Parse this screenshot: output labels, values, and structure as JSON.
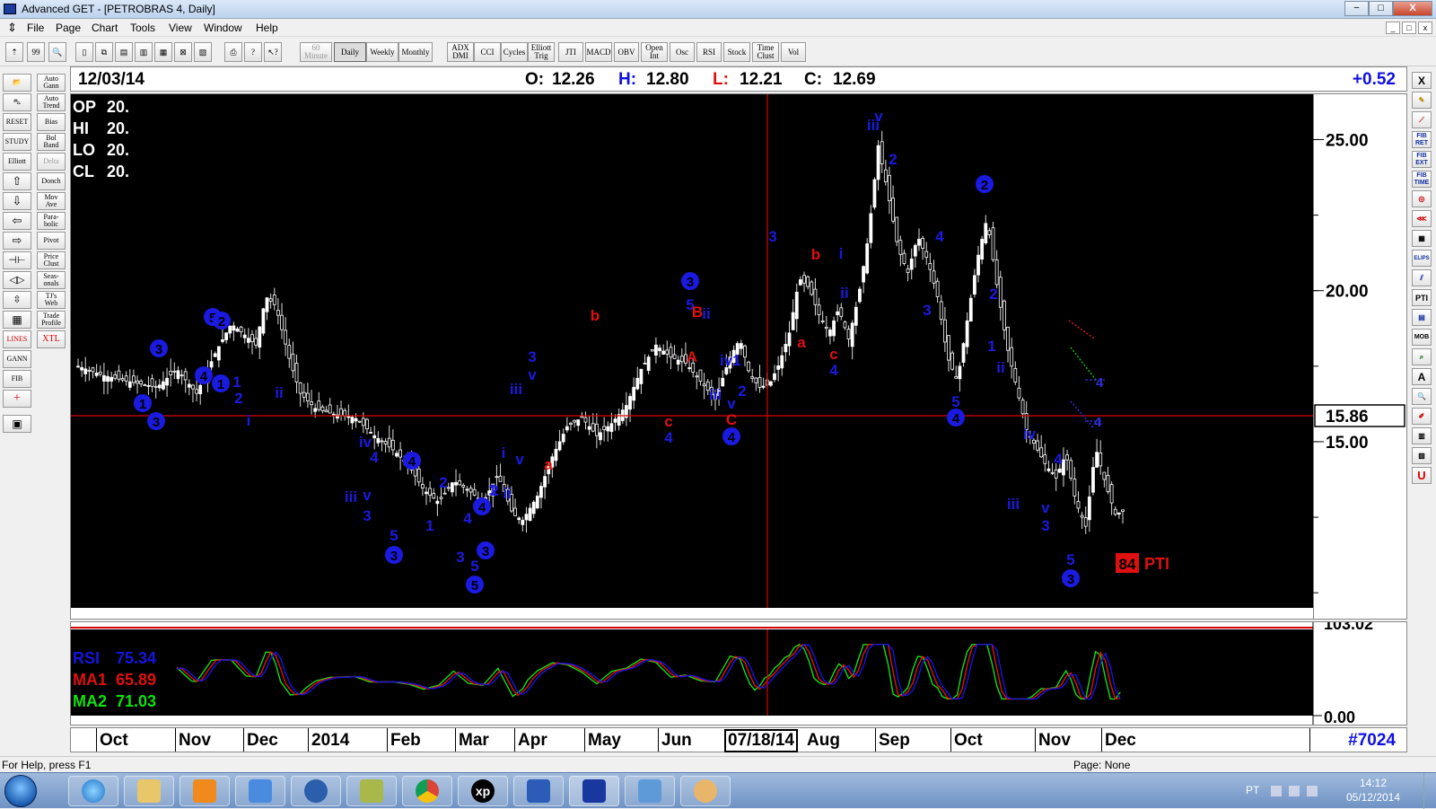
{
  "window": {
    "title": "Advanced GET - [PETROBRAS 4, Daily]",
    "buttons": [
      "−",
      "□",
      "X"
    ]
  },
  "menu": {
    "items": [
      "File",
      "Page",
      "Chart",
      "Tools",
      "View",
      "Window",
      "Help"
    ],
    "mdi_buttons": [
      "_",
      "□",
      "x"
    ]
  },
  "toolbar": {
    "icons": [
      "pointer-icon",
      "quote-icon",
      "zoom-icon",
      "new-icon",
      "copy-icon",
      "page-icon",
      "page2-icon",
      "grid-icon",
      "close-doc-icon",
      "print-icon",
      "help-icon",
      "context-help-icon"
    ],
    "timeframes": {
      "minute": "60\nMinute",
      "daily": "Daily",
      "weekly": "Weekly",
      "monthly": "Monthly"
    },
    "studies": [
      "ADX\nDMI",
      "CCI",
      "Cycles",
      "Elliott\nTrig",
      "JTI",
      "MACD",
      "OBV",
      "Open\nInt",
      "Osc",
      "RSI",
      "Stock",
      "Time\nClust",
      "Vol"
    ]
  },
  "left_tools": {
    "col1_icons": [
      "open-folder-icon",
      "cars-icon",
      "reset-icon",
      "study-icon",
      "elliott-icon",
      "arrow-up-icon",
      "arrow-down-icon",
      "arrow-left-icon",
      "arrow-right-icon",
      "expand-icon",
      "expand-h-icon",
      "compress-icon",
      "grid-icon",
      "lines-icon",
      "gann-icon",
      "fib-icon",
      "crosshair-icon",
      "calculator-icon"
    ],
    "col1_labels": [
      "",
      "",
      "RESET",
      "STUDY",
      "Elliott",
      "",
      "",
      "",
      "",
      "",
      "",
      "",
      "",
      "LINES",
      "GANN",
      "FIB",
      "",
      ""
    ],
    "col2": [
      "Auto\nGann",
      "Auto\nTrend",
      "Bias",
      "Bol\nBand",
      "Delta",
      "Donch",
      "Mov\nAve",
      "Para-\nbolic",
      "Pivot",
      "Price\nClust",
      "Seas-\nonals",
      "TJ's\nWeb",
      "Trade\nProfile",
      "XTL"
    ]
  },
  "right_tools": {
    "icons": [
      "close-icon",
      "pencil-icon",
      "line-icon",
      "fib-ret-icon",
      "fib-ext-icon",
      "fib-time-icon",
      "circle-icon",
      "fan-icon",
      "grid-icon",
      "ellipse-icon",
      "channel-icon",
      "pti-icon",
      "table-icon",
      "mob-icon",
      "magnifier-icon",
      "text-icon",
      "zoom-icon",
      "eraser-icon",
      "layers-icon",
      "layers2-icon",
      "magnet-icon"
    ],
    "labels": [
      "X",
      "",
      "",
      "FIB\nRET",
      "FIB\nEXT",
      "FIB\nTIME",
      "",
      "",
      "",
      "ELIPS",
      "",
      "PTI",
      "",
      "MOB",
      "",
      "A",
      "",
      "",
      "",
      "",
      "U"
    ]
  },
  "info": {
    "date": "12/03/14",
    "open_label": "O:",
    "open": "12.26",
    "high_label": "H:",
    "high": "12.80",
    "low_label": "L:",
    "low": "12.21",
    "close_label": "C:",
    "close": "12.69",
    "change": "+0.52"
  },
  "legend": {
    "op_label": "OP",
    "op_value": "20.",
    "hi_label": "HI",
    "hi_value": "20.",
    "lo_label": "LO",
    "lo_value": "20.",
    "cl_label": "CL",
    "cl_value": "20."
  },
  "chart_data": {
    "type": "candlestick",
    "instrument": "PETROBRAS 4",
    "ylim": [
      9.5,
      26.5
    ],
    "y_ticks": [
      15.0,
      20.0,
      25.0
    ],
    "y_tick_labels": [
      "15.00",
      "20.00",
      "25.00"
    ],
    "crosshair_price": 15.86,
    "crosshair_price_label": "15.86",
    "crosshair_date_label": "07/18/14",
    "x_labels": [
      "Oct",
      "Nov",
      "Dec",
      "2014",
      "Feb",
      "Mar",
      "Apr",
      "May",
      "Jun",
      "Aug",
      "Sep",
      "Oct",
      "Nov",
      "Dec"
    ],
    "bar_count_label": "#7024",
    "pti_value": "84",
    "pti_label": "PTI",
    "price_path": [
      {
        "x": 0,
        "y": 17.5
      },
      {
        "x": 10,
        "y": 17.2
      },
      {
        "x": 20,
        "y": 17.0
      },
      {
        "x": 32,
        "y": 16.8
      },
      {
        "x": 40,
        "y": 17.4
      },
      {
        "x": 48,
        "y": 16.6
      },
      {
        "x": 56,
        "y": 18.0
      },
      {
        "x": 62,
        "y": 18.9
      },
      {
        "x": 68,
        "y": 18.5
      },
      {
        "x": 72,
        "y": 18.2
      },
      {
        "x": 76,
        "y": 19.8
      },
      {
        "x": 80,
        "y": 19.5
      },
      {
        "x": 86,
        "y": 17.6
      },
      {
        "x": 90,
        "y": 16.6
      },
      {
        "x": 96,
        "y": 16.1
      },
      {
        "x": 104,
        "y": 15.9
      },
      {
        "x": 112,
        "y": 15.8
      },
      {
        "x": 120,
        "y": 15.2
      },
      {
        "x": 128,
        "y": 14.7
      },
      {
        "x": 134,
        "y": 14.2
      },
      {
        "x": 140,
        "y": 13.4
      },
      {
        "x": 146,
        "y": 13.0
      },
      {
        "x": 152,
        "y": 13.7
      },
      {
        "x": 158,
        "y": 13.4
      },
      {
        "x": 164,
        "y": 13.0
      },
      {
        "x": 170,
        "y": 13.9
      },
      {
        "x": 176,
        "y": 12.6
      },
      {
        "x": 180,
        "y": 12.4
      },
      {
        "x": 186,
        "y": 13.2
      },
      {
        "x": 192,
        "y": 14.5
      },
      {
        "x": 198,
        "y": 15.5
      },
      {
        "x": 204,
        "y": 15.8
      },
      {
        "x": 210,
        "y": 15.2
      },
      {
        "x": 216,
        "y": 15.6
      },
      {
        "x": 222,
        "y": 16.2
      },
      {
        "x": 228,
        "y": 17.4
      },
      {
        "x": 234,
        "y": 18.2
      },
      {
        "x": 240,
        "y": 17.8
      },
      {
        "x": 246,
        "y": 17.6
      },
      {
        "x": 252,
        "y": 17.0
      },
      {
        "x": 258,
        "y": 16.4
      },
      {
        "x": 264,
        "y": 17.8
      },
      {
        "x": 268,
        "y": 18.4
      },
      {
        "x": 272,
        "y": 17.2
      },
      {
        "x": 276,
        "y": 16.8
      },
      {
        "x": 280,
        "y": 16.9
      },
      {
        "x": 284,
        "y": 17.6
      },
      {
        "x": 288,
        "y": 18.6
      },
      {
        "x": 292,
        "y": 20.4
      },
      {
        "x": 296,
        "y": 20.1
      },
      {
        "x": 300,
        "y": 19.2
      },
      {
        "x": 304,
        "y": 18.6
      },
      {
        "x": 308,
        "y": 19.4
      },
      {
        "x": 312,
        "y": 18.4
      },
      {
        "x": 316,
        "y": 19.8
      },
      {
        "x": 320,
        "y": 21.8
      },
      {
        "x": 324,
        "y": 24.8
      },
      {
        "x": 328,
        "y": 23.2
      },
      {
        "x": 332,
        "y": 21.4
      },
      {
        "x": 336,
        "y": 20.6
      },
      {
        "x": 340,
        "y": 21.8
      },
      {
        "x": 344,
        "y": 21.0
      },
      {
        "x": 348,
        "y": 19.8
      },
      {
        "x": 352,
        "y": 17.8
      },
      {
        "x": 356,
        "y": 17.0
      },
      {
        "x": 360,
        "y": 19.0
      },
      {
        "x": 364,
        "y": 21.0
      },
      {
        "x": 368,
        "y": 22.4
      },
      {
        "x": 372,
        "y": 20.2
      },
      {
        "x": 376,
        "y": 18.2
      },
      {
        "x": 380,
        "y": 16.8
      },
      {
        "x": 384,
        "y": 15.4
      },
      {
        "x": 388,
        "y": 14.8
      },
      {
        "x": 392,
        "y": 14.2
      },
      {
        "x": 396,
        "y": 13.8
      },
      {
        "x": 400,
        "y": 14.6
      },
      {
        "x": 404,
        "y": 13.0
      },
      {
        "x": 408,
        "y": 12.2
      },
      {
        "x": 412,
        "y": 14.8
      },
      {
        "x": 416,
        "y": 13.6
      },
      {
        "x": 420,
        "y": 12.6
      },
      {
        "x": 423,
        "y": 12.69
      }
    ],
    "rsi": {
      "ylim": [
        0,
        103.02
      ],
      "y_tick_labels": [
        "103.02",
        "0.00"
      ],
      "rsi_label": "RSI",
      "rsi_value": "75.34",
      "ma1_label": "MA1",
      "ma1_value": "65.89",
      "ma2_label": "MA2",
      "ma2_value": "71.03",
      "colors": {
        "rsi": "#1515e0",
        "ma1": "#e01010",
        "ma2": "#10e010"
      }
    }
  },
  "status": {
    "help_text": "For Help, press F1",
    "page_text": "Page: None"
  },
  "taskbar": {
    "apps": [
      "ie-icon",
      "explorer-icon",
      "media-player-icon",
      "network-icon",
      "hp-icon",
      "tool-icon",
      "chrome-icon",
      "xp-icon",
      "word-icon",
      "advanced-get-icon",
      "photo-icon",
      "paint-icon"
    ],
    "xp_label": "xp",
    "language": "PT",
    "time": "14:12",
    "date": "05/12/2014"
  }
}
